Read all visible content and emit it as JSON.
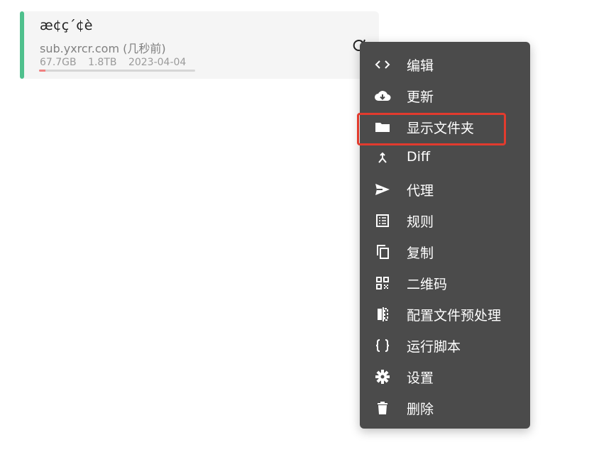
{
  "card": {
    "title": "æ¢ç´¢è",
    "subtitle": "sub.yxrcr.com (几秒前)",
    "meta": {
      "used": "67.7GB",
      "total": "1.8TB",
      "expire": "2023-04-04"
    },
    "usage_fraction": 0.04,
    "accent_color": "#4fc08d",
    "usage_color": "#f08080"
  },
  "menu": {
    "items": [
      {
        "label": "编辑",
        "icon": "code-icon"
      },
      {
        "label": "更新",
        "icon": "cloud-download-icon"
      },
      {
        "label": "显示文件夹",
        "icon": "folder-icon"
      },
      {
        "label": "Diff",
        "icon": "merge-icon"
      },
      {
        "label": "代理",
        "icon": "send-icon"
      },
      {
        "label": "规则",
        "icon": "list-icon"
      },
      {
        "label": "复制",
        "icon": "copy-icon"
      },
      {
        "label": "二维码",
        "icon": "qrcode-icon"
      },
      {
        "label": "配置文件预处理",
        "icon": "compare-icon"
      },
      {
        "label": "运行脚本",
        "icon": "braces-icon"
      },
      {
        "label": "设置",
        "icon": "gear-icon"
      },
      {
        "label": "删除",
        "icon": "trash-icon"
      }
    ],
    "highlighted_index": 2,
    "background_color": "#4b4b4b",
    "highlight_color": "#e23b2e"
  }
}
